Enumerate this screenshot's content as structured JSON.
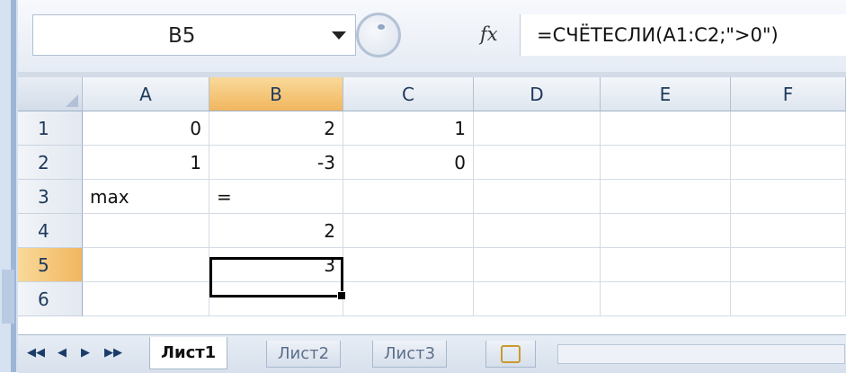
{
  "formula_bar": {
    "name_box": "B5",
    "fx_label": "fx",
    "formula": "=СЧЁТЕСЛИ(A1:C2;\">0\")"
  },
  "columns": [
    "A",
    "B",
    "C",
    "D",
    "E",
    "F"
  ],
  "active_column": "B",
  "rows": [
    {
      "header": "1",
      "cells": [
        "0",
        "2",
        "1",
        "",
        "",
        ""
      ]
    },
    {
      "header": "2",
      "cells": [
        "1",
        "-3",
        "0",
        "",
        "",
        ""
      ]
    },
    {
      "header": "3",
      "cells": [
        "max",
        "=",
        "",
        "",
        "",
        ""
      ]
    },
    {
      "header": "4",
      "cells": [
        "",
        "2",
        "",
        "",
        "",
        ""
      ]
    },
    {
      "header": "5",
      "cells": [
        "",
        "3",
        "",
        "",
        "",
        ""
      ]
    },
    {
      "header": "6",
      "cells": [
        "",
        "",
        "",
        "",
        "",
        ""
      ]
    }
  ],
  "active_row": "5",
  "selected_cell": "B5",
  "sheet_tabs": [
    "Лист1",
    "Лист2",
    "Лист3"
  ],
  "active_tab": "Лист1",
  "nav_buttons": [
    "◀◀",
    "◀",
    "▶",
    "▶▶"
  ]
}
